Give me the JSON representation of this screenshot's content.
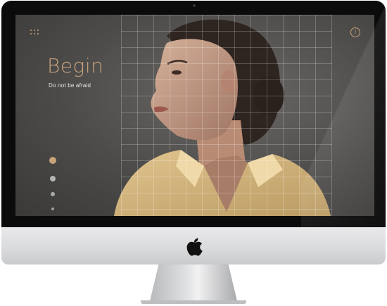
{
  "hero": {
    "title": "Begin",
    "subtitle": "Do not be afraid"
  },
  "icons": {
    "menu": "grid-dots-icon",
    "info": "info-icon",
    "brand": "apple-logo-icon"
  },
  "info_glyph": "i",
  "slider": {
    "count": 4,
    "active_index": 0
  },
  "colors": {
    "accent": "#c8a37a",
    "subtitle": "#e8e6e2",
    "screen_bg": "#4c4b49"
  }
}
